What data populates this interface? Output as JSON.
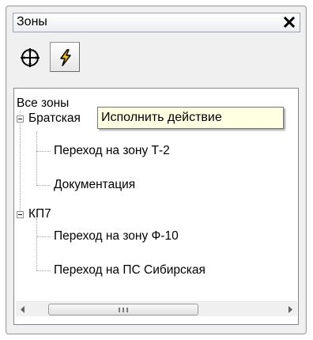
{
  "window": {
    "title": "Зоны",
    "close_glyph": "✕"
  },
  "toolbar": {
    "buttons": [
      {
        "name": "target-button",
        "icon": "crosshair-target-icon"
      },
      {
        "name": "execute-button",
        "icon": "lightning-icon"
      }
    ],
    "tooltip": "Исполнить действие"
  },
  "tree": {
    "root": "Все зоны",
    "groups": [
      {
        "label": "Братская",
        "children": [
          "Переход на зону Т-2",
          "Документация"
        ]
      },
      {
        "label": "КП7",
        "children": [
          "Переход на зону Ф-10",
          "Переход на ПС Сибирская"
        ]
      }
    ]
  },
  "scrollbar": {
    "grip_glyph": "III"
  },
  "colors": {
    "tooltip_bg": "#ffffe1",
    "lightning": "#f2c500"
  }
}
